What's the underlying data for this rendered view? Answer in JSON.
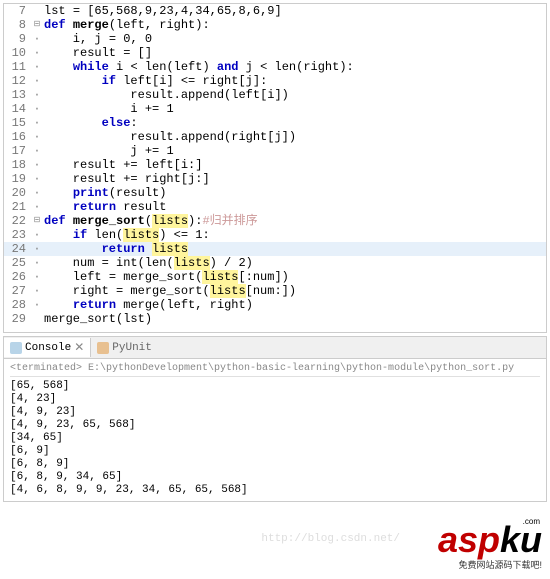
{
  "code": {
    "lines": [
      {
        "num": 7,
        "fold": "",
        "tokens": [
          [
            "id",
            "lst "
          ],
          [
            "op",
            "= "
          ],
          [
            "op",
            "["
          ],
          [
            "num",
            "65"
          ],
          [
            "op",
            ","
          ],
          [
            "num",
            "568"
          ],
          [
            "op",
            ","
          ],
          [
            "num",
            "9"
          ],
          [
            "op",
            ","
          ],
          [
            "num",
            "23"
          ],
          [
            "op",
            ","
          ],
          [
            "num",
            "4"
          ],
          [
            "op",
            ","
          ],
          [
            "num",
            "34"
          ],
          [
            "op",
            ","
          ],
          [
            "num",
            "65"
          ],
          [
            "op",
            ","
          ],
          [
            "num",
            "8"
          ],
          [
            "op",
            ","
          ],
          [
            "num",
            "6"
          ],
          [
            "op",
            ","
          ],
          [
            "num",
            "9"
          ],
          [
            "op",
            "]"
          ]
        ],
        "hl": false
      },
      {
        "num": 8,
        "fold": "minus",
        "tokens": [
          [
            "kw",
            "def"
          ],
          [
            "id",
            " "
          ],
          [
            "fn",
            "merge"
          ],
          [
            "op",
            "("
          ],
          [
            "id",
            "left"
          ],
          [
            "op",
            ", "
          ],
          [
            "id",
            "right"
          ],
          [
            "op",
            "):"
          ]
        ],
        "hl": false
      },
      {
        "num": 9,
        "fold": "dot",
        "tokens": [
          [
            "id",
            "    i"
          ],
          [
            "op",
            ", "
          ],
          [
            "id",
            "j "
          ],
          [
            "op",
            "= "
          ],
          [
            "num",
            "0"
          ],
          [
            "op",
            ", "
          ],
          [
            "num",
            "0"
          ]
        ],
        "hl": false
      },
      {
        "num": 10,
        "fold": "dot",
        "tokens": [
          [
            "id",
            "    result "
          ],
          [
            "op",
            "= []"
          ]
        ],
        "hl": false
      },
      {
        "num": 11,
        "fold": "dot",
        "tokens": [
          [
            "id",
            "    "
          ],
          [
            "kw",
            "while"
          ],
          [
            "id",
            " i "
          ],
          [
            "op",
            "< "
          ],
          [
            "id",
            "len"
          ],
          [
            "op",
            "("
          ],
          [
            "id",
            "left"
          ],
          [
            "op",
            ") "
          ],
          [
            "kw",
            "and"
          ],
          [
            "id",
            " j "
          ],
          [
            "op",
            "< "
          ],
          [
            "id",
            "len"
          ],
          [
            "op",
            "("
          ],
          [
            "id",
            "right"
          ],
          [
            "op",
            "):"
          ]
        ],
        "hl": false
      },
      {
        "num": 12,
        "fold": "dot",
        "tokens": [
          [
            "id",
            "        "
          ],
          [
            "kw",
            "if"
          ],
          [
            "id",
            " left"
          ],
          [
            "op",
            "["
          ],
          [
            "id",
            "i"
          ],
          [
            "op",
            "] <= "
          ],
          [
            "id",
            "right"
          ],
          [
            "op",
            "["
          ],
          [
            "id",
            "j"
          ],
          [
            "op",
            "]:"
          ]
        ],
        "hl": false
      },
      {
        "num": 13,
        "fold": "dot",
        "tokens": [
          [
            "id",
            "            result"
          ],
          [
            "op",
            "."
          ],
          [
            "id",
            "append"
          ],
          [
            "op",
            "("
          ],
          [
            "id",
            "left"
          ],
          [
            "op",
            "["
          ],
          [
            "id",
            "i"
          ],
          [
            "op",
            "])"
          ]
        ],
        "hl": false
      },
      {
        "num": 14,
        "fold": "dot",
        "tokens": [
          [
            "id",
            "            i "
          ],
          [
            "op",
            "+= "
          ],
          [
            "num",
            "1"
          ]
        ],
        "hl": false
      },
      {
        "num": 15,
        "fold": "dot",
        "tokens": [
          [
            "id",
            "        "
          ],
          [
            "kw",
            "else"
          ],
          [
            "op",
            ":"
          ]
        ],
        "hl": false
      },
      {
        "num": 16,
        "fold": "dot",
        "tokens": [
          [
            "id",
            "            result"
          ],
          [
            "op",
            "."
          ],
          [
            "id",
            "append"
          ],
          [
            "op",
            "("
          ],
          [
            "id",
            "right"
          ],
          [
            "op",
            "["
          ],
          [
            "id",
            "j"
          ],
          [
            "op",
            "])"
          ]
        ],
        "hl": false
      },
      {
        "num": 17,
        "fold": "dot",
        "tokens": [
          [
            "id",
            "            j "
          ],
          [
            "op",
            "+= "
          ],
          [
            "num",
            "1"
          ]
        ],
        "hl": false
      },
      {
        "num": 18,
        "fold": "dot",
        "tokens": [
          [
            "id",
            "    result "
          ],
          [
            "op",
            "+= "
          ],
          [
            "id",
            "left"
          ],
          [
            "op",
            "["
          ],
          [
            "id",
            "i"
          ],
          [
            "op",
            ":]"
          ]
        ],
        "hl": false
      },
      {
        "num": 19,
        "fold": "dot",
        "tokens": [
          [
            "id",
            "    result "
          ],
          [
            "op",
            "+= "
          ],
          [
            "id",
            "right"
          ],
          [
            "op",
            "["
          ],
          [
            "id",
            "j"
          ],
          [
            "op",
            ":]"
          ]
        ],
        "hl": false
      },
      {
        "num": 20,
        "fold": "dot",
        "tokens": [
          [
            "id",
            "    "
          ],
          [
            "kw",
            "print"
          ],
          [
            "op",
            "("
          ],
          [
            "id",
            "result"
          ],
          [
            "op",
            ")"
          ]
        ],
        "hl": false
      },
      {
        "num": 21,
        "fold": "dot",
        "tokens": [
          [
            "id",
            "    "
          ],
          [
            "kw",
            "return"
          ],
          [
            "id",
            " result"
          ]
        ],
        "hl": false
      },
      {
        "num": 22,
        "fold": "minus",
        "tokens": [
          [
            "kw",
            "def"
          ],
          [
            "id",
            " "
          ],
          [
            "fn",
            "merge_sort"
          ],
          [
            "op",
            "("
          ],
          [
            "hilite",
            "lists"
          ],
          [
            "op",
            "):"
          ],
          [
            "comment",
            "#归并排序"
          ]
        ],
        "hl": false
      },
      {
        "num": 23,
        "fold": "dot",
        "tokens": [
          [
            "id",
            "    "
          ],
          [
            "kw",
            "if"
          ],
          [
            "id",
            " len"
          ],
          [
            "op",
            "("
          ],
          [
            "hilite",
            "lists"
          ],
          [
            "op",
            ") <= "
          ],
          [
            "num",
            "1"
          ],
          [
            "op",
            ":"
          ]
        ],
        "hl": false
      },
      {
        "num": 24,
        "fold": "dot",
        "tokens": [
          [
            "id",
            "        "
          ],
          [
            "kw",
            "return"
          ],
          [
            "id",
            " "
          ],
          [
            "hilite",
            "lists"
          ]
        ],
        "hl": true
      },
      {
        "num": 25,
        "fold": "dot",
        "tokens": [
          [
            "id",
            "    num "
          ],
          [
            "op",
            "= "
          ],
          [
            "id",
            "int"
          ],
          [
            "op",
            "("
          ],
          [
            "id",
            "len"
          ],
          [
            "op",
            "("
          ],
          [
            "hilite",
            "lists"
          ],
          [
            "op",
            ") / "
          ],
          [
            "num",
            "2"
          ],
          [
            "op",
            ")"
          ]
        ],
        "hl": false
      },
      {
        "num": 26,
        "fold": "dot",
        "tokens": [
          [
            "id",
            "    left "
          ],
          [
            "op",
            "= "
          ],
          [
            "id",
            "merge_sort"
          ],
          [
            "op",
            "("
          ],
          [
            "hilite",
            "lists"
          ],
          [
            "op",
            "[:"
          ],
          [
            "id",
            "num"
          ],
          [
            "op",
            "])"
          ]
        ],
        "hl": false
      },
      {
        "num": 27,
        "fold": "dot",
        "tokens": [
          [
            "id",
            "    right "
          ],
          [
            "op",
            "= "
          ],
          [
            "id",
            "merge_sort"
          ],
          [
            "op",
            "("
          ],
          [
            "hilite",
            "lists"
          ],
          [
            "op",
            "["
          ],
          [
            "id",
            "num"
          ],
          [
            "op",
            ":])"
          ]
        ],
        "hl": false
      },
      {
        "num": 28,
        "fold": "dot",
        "tokens": [
          [
            "id",
            "    "
          ],
          [
            "kw",
            "return"
          ],
          [
            "id",
            " merge"
          ],
          [
            "op",
            "("
          ],
          [
            "id",
            "left"
          ],
          [
            "op",
            ", "
          ],
          [
            "id",
            "right"
          ],
          [
            "op",
            ")"
          ]
        ],
        "hl": false
      },
      {
        "num": 29,
        "fold": "",
        "tokens": [
          [
            "id",
            "merge_sort"
          ],
          [
            "op",
            "("
          ],
          [
            "id",
            "lst"
          ],
          [
            "op",
            ")"
          ]
        ],
        "hl": false
      }
    ]
  },
  "console": {
    "tabs": {
      "console_label": "Console",
      "pyunit_label": "PyUnit"
    },
    "terminated": "<terminated> E:\\pythonDevelopment\\python-basic-learning\\python-module\\python_sort.py",
    "output": [
      "[65, 568]",
      "[4, 23]",
      "[4, 9, 23]",
      "[4, 9, 23, 65, 568]",
      "[34, 65]",
      "[6, 9]",
      "[6, 8, 9]",
      "[6, 8, 9, 34, 65]",
      "[4, 6, 8, 9, 9, 23, 34, 65, 65, 568]"
    ]
  },
  "watermark": {
    "asp": "asp",
    "ku": "ku",
    "top": ".com",
    "sub": "免费网站源码下载吧!",
    "url": "http://blog.csdn.net/"
  }
}
